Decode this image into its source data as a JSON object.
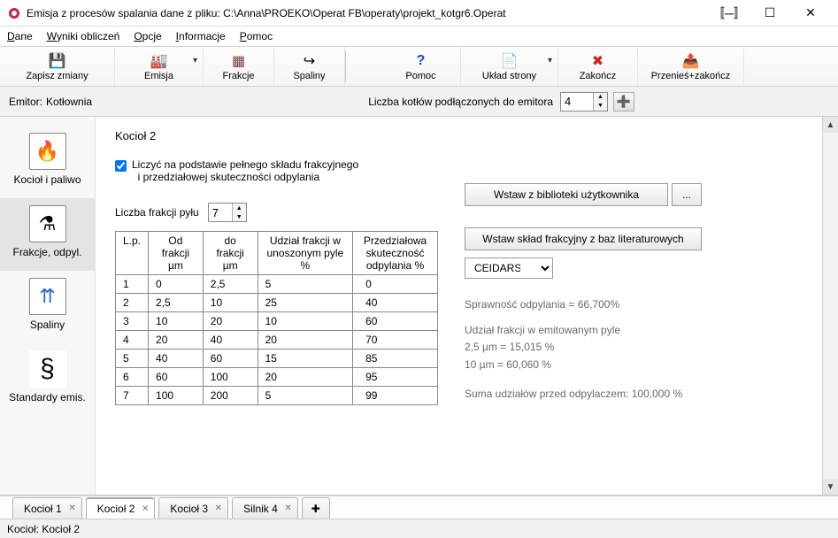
{
  "window": {
    "title": "Emisja z procesów spalania   dane z pliku: C:\\Anna\\PROEKO\\Operat FB\\operaty\\projekt_kotgr6.Operat"
  },
  "menu": {
    "dane": "Dane",
    "wyniki": "Wyniki obliczeń",
    "opcje": "Opcje",
    "informacje": "Informacje",
    "pomoc": "Pomoc"
  },
  "toolbar": {
    "zapisz": "Zapisz zmiany",
    "emisja": "Emisja",
    "frakcje": "Frakcje",
    "spaliny": "Spaliny",
    "pomoc": "Pomoc",
    "uklad": "Układ strony",
    "zakoncz": "Zakończ",
    "przenies": "Przenieś+zakończ"
  },
  "emitorbar": {
    "label_emitor": "Emitor:",
    "emitor_value": "Kotłownia",
    "label_liczba": "Liczba kotłów podłączonych do emitora",
    "liczba_value": "4"
  },
  "sidebar": {
    "kociol": "Kocioł i paliwo",
    "frakcje": "Frakcje, odpyl.",
    "spaliny": "Spaliny",
    "standardy": "Standardy emis."
  },
  "content": {
    "heading": "Kocioł 2",
    "check_label_l1": "Liczyć na podstawie pełnego składu frakcyjnego",
    "check_label_l2": "i przedziałowej skuteczności odpylania",
    "liczba_frakcji_label": "Liczba frakcji pyłu",
    "liczba_frakcji_value": "7",
    "btn_biblio": "Wstaw z biblioteki użytkownika",
    "btn_biblio_more": "...",
    "btn_baz": "Wstaw skład frakcyjny z baz literaturowych",
    "db_selected": "CEIDARS",
    "table": {
      "h_lp": "L.p.",
      "h_od": "Od frakcji µm",
      "h_do": "do frakcji µm",
      "h_udzial": "Udział frakcji w unoszonym pyle %",
      "h_skut": "Przedziałowa skuteczność odpylania %",
      "rows": [
        {
          "lp": "1",
          "od": "0",
          "do": "2,5",
          "ud": "5",
          "sk": "0"
        },
        {
          "lp": "2",
          "od": "2,5",
          "do": "10",
          "ud": "25",
          "sk": "40"
        },
        {
          "lp": "3",
          "od": "10",
          "do": "20",
          "ud": "10",
          "sk": "60"
        },
        {
          "lp": "4",
          "od": "20",
          "do": "40",
          "ud": "20",
          "sk": "70"
        },
        {
          "lp": "5",
          "od": "40",
          "do": "60",
          "ud": "15",
          "sk": "85"
        },
        {
          "lp": "6",
          "od": "60",
          "do": "100",
          "ud": "20",
          "sk": "95"
        },
        {
          "lp": "7",
          "od": "100",
          "do": "200",
          "ud": "5",
          "sk": "99"
        }
      ]
    },
    "stats": {
      "l1": "Sprawność odpylania =  66,700%",
      "l2": "Udział frakcji w emitowanym pyle",
      "l3": "2,5 µm = 15,015 %",
      "l4": "10 µm = 60,060 %",
      "l5": "Suma udziałów przed odpylaczem: 100,000 %"
    }
  },
  "tabs": {
    "t1": "Kocioł 1",
    "t2": "Kocioł 2",
    "t3": "Kocioł 3",
    "t4": "Silnik 4"
  },
  "statusbar": {
    "text": "Kocioł: Kocioł 2"
  }
}
